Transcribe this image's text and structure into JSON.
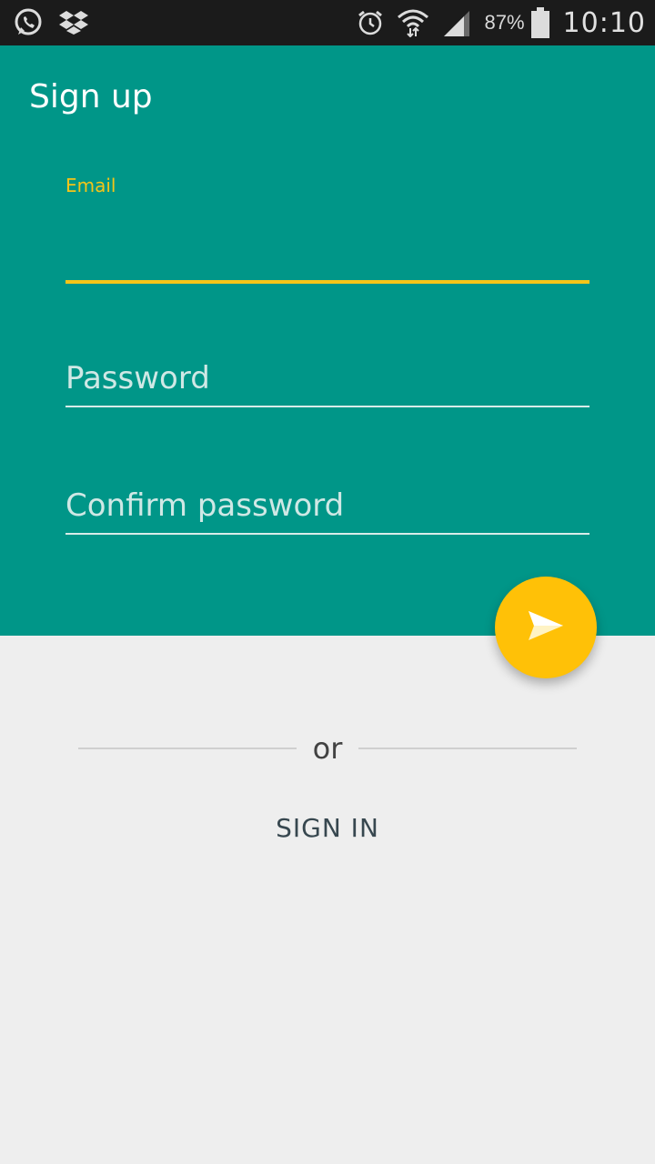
{
  "status_bar": {
    "icons_left": [
      "whatsapp-icon",
      "dropbox-icon"
    ],
    "icons_right": [
      "alarm-icon",
      "wifi-icon",
      "signal-icon",
      "battery-icon"
    ],
    "battery_percent": "87%",
    "time": "10:10"
  },
  "app": {
    "title": "Sign up"
  },
  "form": {
    "email": {
      "label": "Email",
      "value": ""
    },
    "password": {
      "placeholder": "Password",
      "value": ""
    },
    "confirm_password": {
      "placeholder": "Confirm password",
      "value": ""
    },
    "submit_icon": "send-icon"
  },
  "alternate": {
    "divider_text": "or",
    "sign_in_label": "SIGN IN"
  },
  "colors": {
    "primary": "#009688",
    "accent": "#ffc107",
    "background": "#eeeeee"
  }
}
